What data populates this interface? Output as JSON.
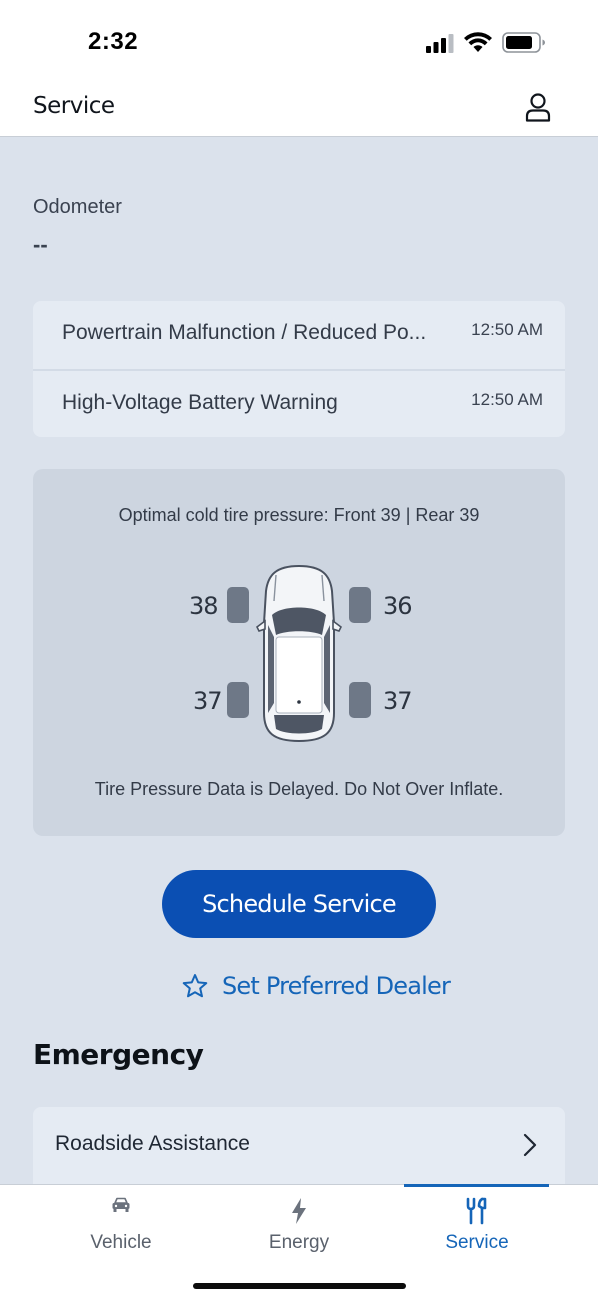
{
  "status_bar": {
    "time": "2:32"
  },
  "header": {
    "title": "Service",
    "profile_icon": "person-icon"
  },
  "odometer": {
    "label": "Odometer",
    "value": "--"
  },
  "alerts": [
    {
      "text": "Powertrain Malfunction / Reduced Po...",
      "time": "12:50 AM"
    },
    {
      "text": "High-Voltage Battery Warning",
      "time": "12:50 AM"
    }
  ],
  "tire_pressure": {
    "optimal_text": "Optimal cold tire pressure: Front 39 | Rear 39",
    "front_left": "38",
    "front_right": "36",
    "rear_left": "37",
    "rear_right": "37",
    "warning_text": "Tire Pressure Data is Delayed. Do Not Over Inflate."
  },
  "actions": {
    "schedule_service": "Schedule Service",
    "set_preferred_dealer": "Set Preferred Dealer"
  },
  "emergency": {
    "title": "Emergency",
    "roadside_assistance": "Roadside Assistance"
  },
  "tabs": [
    {
      "label": "Vehicle",
      "icon": "car-icon",
      "active": false
    },
    {
      "label": "Energy",
      "icon": "lightning-icon",
      "active": false
    },
    {
      "label": "Service",
      "icon": "tools-icon",
      "active": true
    }
  ],
  "colors": {
    "accent": "#0b4fb3",
    "link": "#1565b8",
    "background": "#dbe2ec"
  }
}
